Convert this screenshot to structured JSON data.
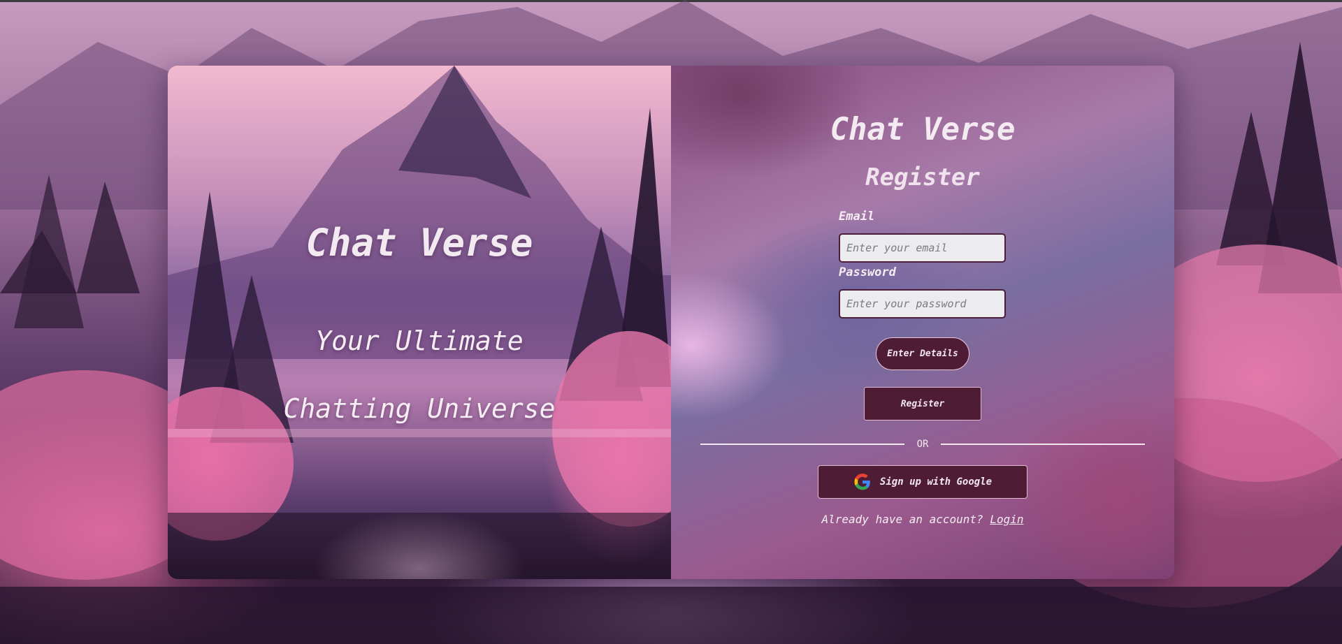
{
  "hero": {
    "title": "Chat Verse",
    "tagline_line1": "Your Ultimate",
    "tagline_line2": "Chatting Universe"
  },
  "form": {
    "brand": "Chat Verse",
    "heading": "Register",
    "email": {
      "label": "Email",
      "placeholder": "Enter your email",
      "value": ""
    },
    "password": {
      "label": "Password",
      "placeholder": "Enter your password",
      "value": ""
    },
    "enter_details_label": "Enter Details",
    "register_label": "Register",
    "divider_text": "OR",
    "google_label": "Sign up with Google",
    "google_icon": "google-icon",
    "login_prompt": "Already have an account?",
    "login_link": "Login"
  },
  "colors": {
    "button_bg": "#4e1d35",
    "text_light": "#f3ebf1",
    "input_bg": "#ecebed",
    "input_border": "#4a1e3a"
  }
}
